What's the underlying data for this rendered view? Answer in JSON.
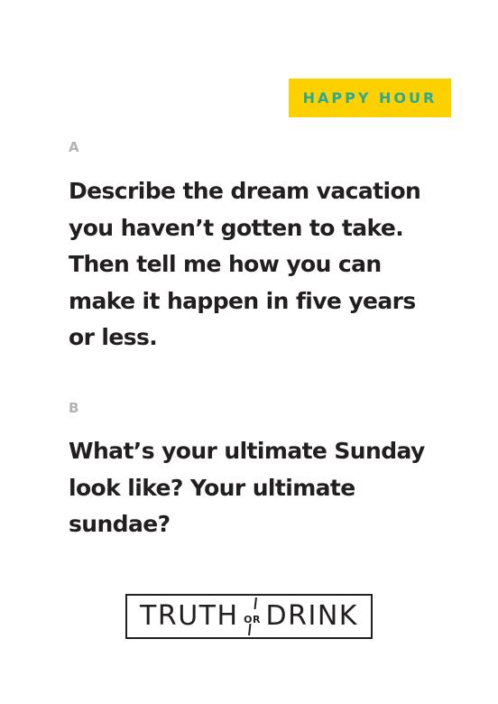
{
  "badge": {
    "label": "HAPPY HOUR",
    "background_color": "#fdd000",
    "text_color": "#2aa89a"
  },
  "questions": [
    {
      "letter": "A",
      "text": "Describe the dream vacation you haven’t gotten to take. Then tell me how you can make it happen in five years or less."
    },
    {
      "letter": "B",
      "text": "What’s your ultimate Sunday look like? Your ultimate sundae?"
    }
  ],
  "logo": {
    "word_left": "TRUTH",
    "word_middle": "OR",
    "word_right": "DRINK"
  },
  "colors": {
    "text": "#231f20",
    "letter": "#b3b3b3",
    "background": "#ffffff"
  }
}
